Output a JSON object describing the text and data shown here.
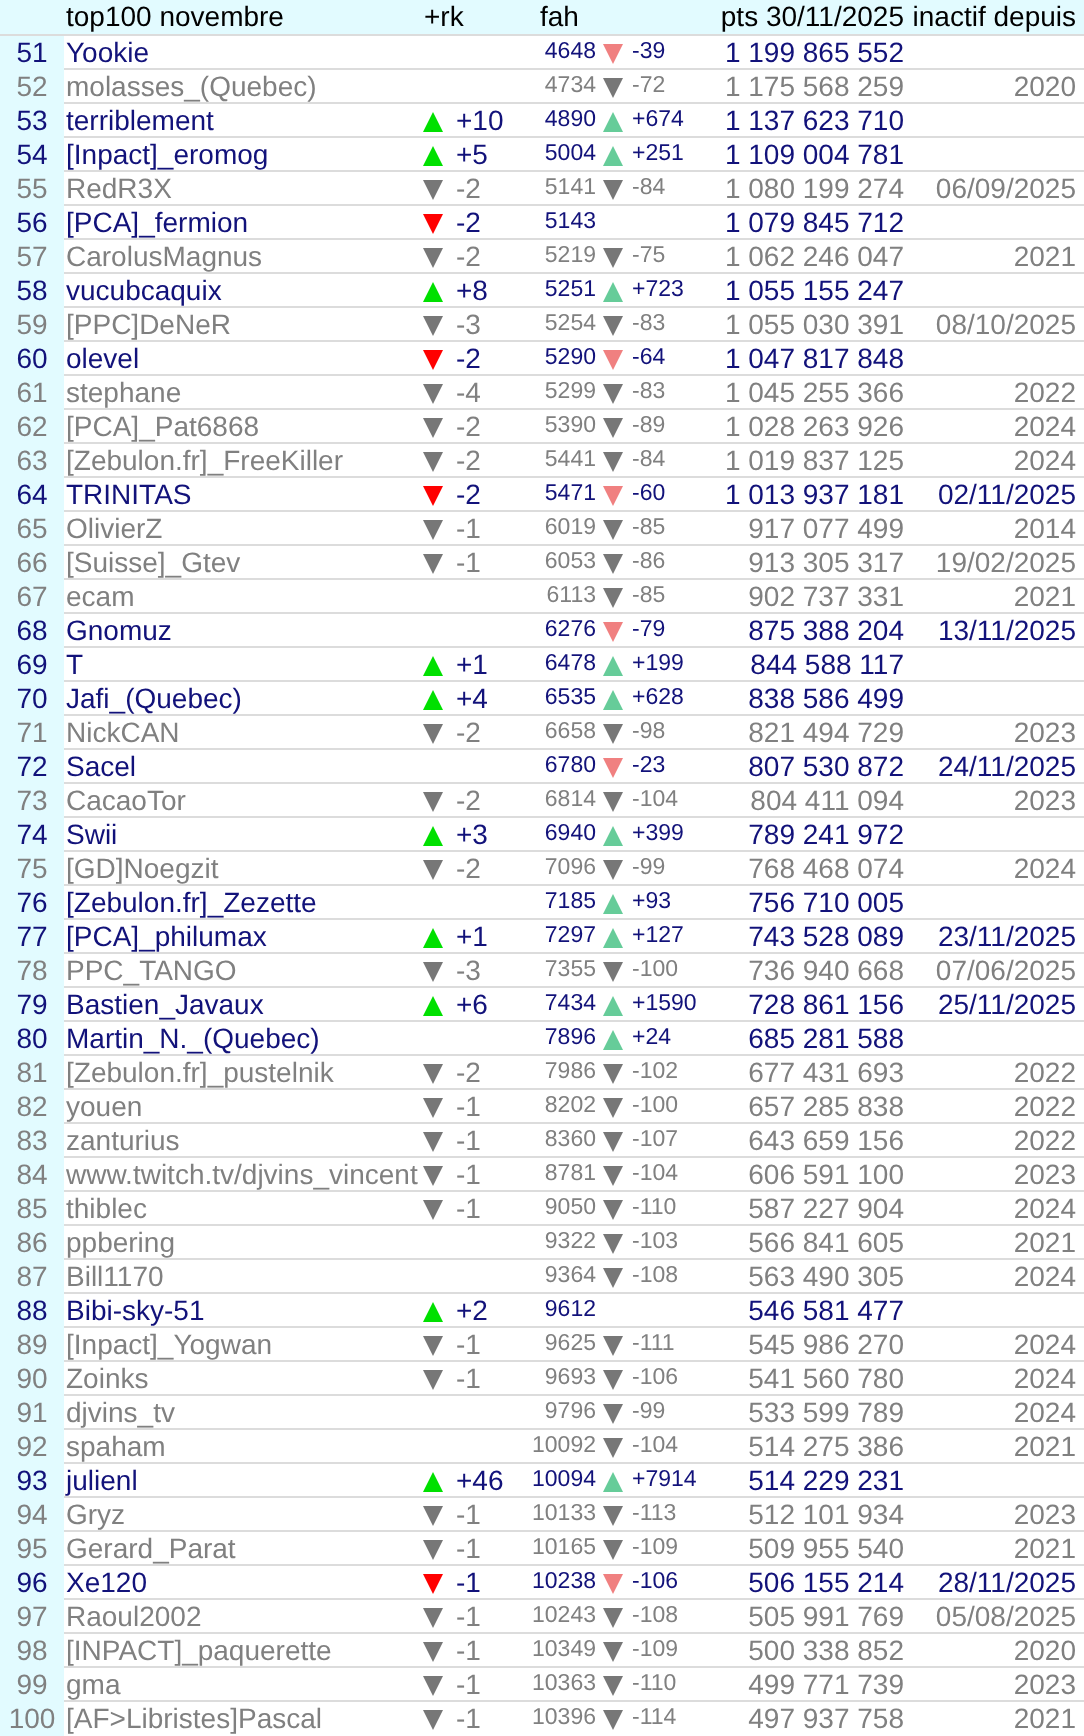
{
  "header": {
    "name": "top100 novembre",
    "rank_change": "+rk",
    "fah": "fah",
    "points": "pts 30/11/2025",
    "inactive_since": "inactif depuis"
  },
  "rows": [
    {
      "rank": "51",
      "name": "Yookie",
      "active": true,
      "fah": "4648",
      "fah_change": {
        "kind": "down",
        "value": "-39"
      },
      "points": "1 199 865 552"
    },
    {
      "rank": "52",
      "name": "molasses_(Quebec)",
      "active": false,
      "fah": "4734",
      "fah_change": {
        "kind": "down",
        "value": "-72"
      },
      "points": "1 175 568 259",
      "inactive_since": "2020"
    },
    {
      "rank": "53",
      "name": "terriblement",
      "active": true,
      "rank_change": {
        "kind": "up",
        "value": "+10"
      },
      "fah": "4890",
      "fah_change": {
        "kind": "up",
        "value": "+674"
      },
      "points": "1 137 623 710"
    },
    {
      "rank": "54",
      "name": "[Inpact]_eromog",
      "active": true,
      "rank_change": {
        "kind": "up",
        "value": "+5"
      },
      "fah": "5004",
      "fah_change": {
        "kind": "up",
        "value": "+251"
      },
      "points": "1 109 004 781"
    },
    {
      "rank": "55",
      "name": "RedR3X",
      "active": false,
      "rank_change": {
        "kind": "down",
        "value": "-2"
      },
      "fah": "5141",
      "fah_change": {
        "kind": "down",
        "value": "-84"
      },
      "points": "1 080 199 274",
      "inactive_since": "06/09/2025"
    },
    {
      "rank": "56",
      "name": "[PCA]_fermion",
      "active": true,
      "rank_change": {
        "kind": "down",
        "value": "-2"
      },
      "fah": "5143",
      "points": "1 079 845 712"
    },
    {
      "rank": "57",
      "name": "CarolusMagnus",
      "active": false,
      "rank_change": {
        "kind": "down",
        "value": "-2"
      },
      "fah": "5219",
      "fah_change": {
        "kind": "down",
        "value": "-75"
      },
      "points": "1 062 246 047",
      "inactive_since": "2021"
    },
    {
      "rank": "58",
      "name": "vucubcaquix",
      "active": true,
      "rank_change": {
        "kind": "up",
        "value": "+8"
      },
      "fah": "5251",
      "fah_change": {
        "kind": "up",
        "value": "+723"
      },
      "points": "1 055 155 247"
    },
    {
      "rank": "59",
      "name": "[PPC]DeNeR",
      "active": false,
      "rank_change": {
        "kind": "down",
        "value": "-3"
      },
      "fah": "5254",
      "fah_change": {
        "kind": "down",
        "value": "-83"
      },
      "points": "1 055 030 391",
      "inactive_since": "08/10/2025"
    },
    {
      "rank": "60",
      "name": "olevel",
      "active": true,
      "rank_change": {
        "kind": "down",
        "value": "-2"
      },
      "fah": "5290",
      "fah_change": {
        "kind": "down",
        "value": "-64"
      },
      "points": "1 047 817 848"
    },
    {
      "rank": "61",
      "name": "stephane",
      "active": false,
      "rank_change": {
        "kind": "down",
        "value": "-4"
      },
      "fah": "5299",
      "fah_change": {
        "kind": "down",
        "value": "-83"
      },
      "points": "1 045 255 366",
      "inactive_since": "2022"
    },
    {
      "rank": "62",
      "name": "[PCA]_Pat6868",
      "active": false,
      "rank_change": {
        "kind": "down",
        "value": "-2"
      },
      "fah": "5390",
      "fah_change": {
        "kind": "down",
        "value": "-89"
      },
      "points": "1 028 263 926",
      "inactive_since": "2024"
    },
    {
      "rank": "63",
      "name": "[Zebulon.fr]_FreeKiller",
      "active": false,
      "rank_change": {
        "kind": "down",
        "value": "-2"
      },
      "fah": "5441",
      "fah_change": {
        "kind": "down",
        "value": "-84"
      },
      "points": "1 019 837 125",
      "inactive_since": "2024"
    },
    {
      "rank": "64",
      "name": "TRINITAS",
      "active": true,
      "rank_change": {
        "kind": "down",
        "value": "-2"
      },
      "fah": "5471",
      "fah_change": {
        "kind": "down",
        "value": "-60"
      },
      "points": "1 013 937 181",
      "inactive_since": "02/11/2025"
    },
    {
      "rank": "65",
      "name": "OlivierZ",
      "active": false,
      "rank_change": {
        "kind": "down",
        "value": "-1"
      },
      "fah": "6019",
      "fah_change": {
        "kind": "down",
        "value": "-85"
      },
      "points": "917 077 499",
      "inactive_since": "2014"
    },
    {
      "rank": "66",
      "name": "[Suisse]_Gtev",
      "active": false,
      "rank_change": {
        "kind": "down",
        "value": "-1"
      },
      "fah": "6053",
      "fah_change": {
        "kind": "down",
        "value": "-86"
      },
      "points": "913 305 317",
      "inactive_since": "19/02/2025"
    },
    {
      "rank": "67",
      "name": "ecam",
      "active": false,
      "fah": "6113",
      "fah_change": {
        "kind": "down",
        "value": "-85"
      },
      "points": "902 737 331",
      "inactive_since": "2021"
    },
    {
      "rank": "68",
      "name": "Gnomuz",
      "active": true,
      "fah": "6276",
      "fah_change": {
        "kind": "down",
        "value": "-79"
      },
      "points": "875 388 204",
      "inactive_since": "13/11/2025"
    },
    {
      "rank": "69",
      "name": "T",
      "active": true,
      "rank_change": {
        "kind": "up",
        "value": "+1"
      },
      "fah": "6478",
      "fah_change": {
        "kind": "up",
        "value": "+199"
      },
      "points": "844 588 117"
    },
    {
      "rank": "70",
      "name": "Jafi_(Quebec)",
      "active": true,
      "rank_change": {
        "kind": "up",
        "value": "+4"
      },
      "fah": "6535",
      "fah_change": {
        "kind": "up",
        "value": "+628"
      },
      "points": "838 586 499"
    },
    {
      "rank": "71",
      "name": "NickCAN",
      "active": false,
      "rank_change": {
        "kind": "down",
        "value": "-2"
      },
      "fah": "6658",
      "fah_change": {
        "kind": "down",
        "value": "-98"
      },
      "points": "821 494 729",
      "inactive_since": "2023"
    },
    {
      "rank": "72",
      "name": "Sacel",
      "active": true,
      "fah": "6780",
      "fah_change": {
        "kind": "down",
        "value": "-23"
      },
      "points": "807 530 872",
      "inactive_since": "24/11/2025"
    },
    {
      "rank": "73",
      "name": "CacaoTor",
      "active": false,
      "rank_change": {
        "kind": "down",
        "value": "-2"
      },
      "fah": "6814",
      "fah_change": {
        "kind": "down",
        "value": "-104"
      },
      "points": "804 411 094",
      "inactive_since": "2023"
    },
    {
      "rank": "74",
      "name": "Swii",
      "active": true,
      "rank_change": {
        "kind": "up",
        "value": "+3"
      },
      "fah": "6940",
      "fah_change": {
        "kind": "up",
        "value": "+399"
      },
      "points": "789 241 972"
    },
    {
      "rank": "75",
      "name": "[GD]Noegzit",
      "active": false,
      "rank_change": {
        "kind": "down",
        "value": "-2"
      },
      "fah": "7096",
      "fah_change": {
        "kind": "down",
        "value": "-99"
      },
      "points": "768 468 074",
      "inactive_since": "2024"
    },
    {
      "rank": "76",
      "name": "[Zebulon.fr]_Zezette",
      "active": true,
      "fah": "7185",
      "fah_change": {
        "kind": "up",
        "value": "+93"
      },
      "points": "756 710 005"
    },
    {
      "rank": "77",
      "name": "[PCA]_philumax",
      "active": true,
      "rank_change": {
        "kind": "up",
        "value": "+1"
      },
      "fah": "7297",
      "fah_change": {
        "kind": "up",
        "value": "+127"
      },
      "points": "743 528 089",
      "inactive_since": "23/11/2025"
    },
    {
      "rank": "78",
      "name": "PPC_TANGO",
      "active": false,
      "rank_change": {
        "kind": "down",
        "value": "-3"
      },
      "fah": "7355",
      "fah_change": {
        "kind": "down",
        "value": "-100"
      },
      "points": "736 940 668",
      "inactive_since": "07/06/2025"
    },
    {
      "rank": "79",
      "name": "Bastien_Javaux",
      "active": true,
      "rank_change": {
        "kind": "up",
        "value": "+6"
      },
      "fah": "7434",
      "fah_change": {
        "kind": "up",
        "value": "+1590"
      },
      "points": "728 861 156",
      "inactive_since": "25/11/2025"
    },
    {
      "rank": "80",
      "name": "Martin_N._(Quebec)",
      "active": true,
      "fah": "7896",
      "fah_change": {
        "kind": "up",
        "value": "+24"
      },
      "points": "685 281 588"
    },
    {
      "rank": "81",
      "name": "[Zebulon.fr]_pustelnik",
      "active": false,
      "rank_change": {
        "kind": "down",
        "value": "-2"
      },
      "fah": "7986",
      "fah_change": {
        "kind": "down",
        "value": "-102"
      },
      "points": "677 431 693",
      "inactive_since": "2022"
    },
    {
      "rank": "82",
      "name": "youen",
      "active": false,
      "rank_change": {
        "kind": "down",
        "value": "-1"
      },
      "fah": "8202",
      "fah_change": {
        "kind": "down",
        "value": "-100"
      },
      "points": "657 285 838",
      "inactive_since": "2022"
    },
    {
      "rank": "83",
      "name": "zanturius",
      "active": false,
      "rank_change": {
        "kind": "down",
        "value": "-1"
      },
      "fah": "8360",
      "fah_change": {
        "kind": "down",
        "value": "-107"
      },
      "points": "643 659 156",
      "inactive_since": "2022"
    },
    {
      "rank": "84",
      "name": "www.twitch.tv/djvins_vincent",
      "active": false,
      "rank_change": {
        "kind": "down",
        "value": "-1"
      },
      "fah": "8781",
      "fah_change": {
        "kind": "down",
        "value": "-104"
      },
      "points": "606 591 100",
      "inactive_since": "2023"
    },
    {
      "rank": "85",
      "name": "thiblec",
      "active": false,
      "rank_change": {
        "kind": "down",
        "value": "-1"
      },
      "fah": "9050",
      "fah_change": {
        "kind": "down",
        "value": "-110"
      },
      "points": "587 227 904",
      "inactive_since": "2024"
    },
    {
      "rank": "86",
      "name": "ppbering",
      "active": false,
      "fah": "9322",
      "fah_change": {
        "kind": "down",
        "value": "-103"
      },
      "points": "566 841 605",
      "inactive_since": "2021"
    },
    {
      "rank": "87",
      "name": "Bill1170",
      "active": false,
      "fah": "9364",
      "fah_change": {
        "kind": "down",
        "value": "-108"
      },
      "points": "563 490 305",
      "inactive_since": "2024"
    },
    {
      "rank": "88",
      "name": "Bibi-sky-51",
      "active": true,
      "rank_change": {
        "kind": "up",
        "value": "+2"
      },
      "fah": "9612",
      "points": "546 581 477"
    },
    {
      "rank": "89",
      "name": "[Inpact]_Yogwan",
      "active": false,
      "rank_change": {
        "kind": "down",
        "value": "-1"
      },
      "fah": "9625",
      "fah_change": {
        "kind": "down",
        "value": "-111"
      },
      "points": "545 986 270",
      "inactive_since": "2024"
    },
    {
      "rank": "90",
      "name": "Zoinks",
      "active": false,
      "rank_change": {
        "kind": "down",
        "value": "-1"
      },
      "fah": "9693",
      "fah_change": {
        "kind": "down",
        "value": "-106"
      },
      "points": "541 560 780",
      "inactive_since": "2024"
    },
    {
      "rank": "91",
      "name": "djvins_tv",
      "active": false,
      "fah": "9796",
      "fah_change": {
        "kind": "down",
        "value": "-99"
      },
      "points": "533 599 789",
      "inactive_since": "2024"
    },
    {
      "rank": "92",
      "name": "spaham",
      "active": false,
      "fah": "10092",
      "fah_change": {
        "kind": "down",
        "value": "-104"
      },
      "points": "514 275 386",
      "inactive_since": "2021"
    },
    {
      "rank": "93",
      "name": "julienl",
      "active": true,
      "rank_change": {
        "kind": "up",
        "value": "+46"
      },
      "fah": "10094",
      "fah_change": {
        "kind": "up",
        "value": "+7914"
      },
      "points": "514 229 231"
    },
    {
      "rank": "94",
      "name": "Gryz",
      "active": false,
      "rank_change": {
        "kind": "down",
        "value": "-1"
      },
      "fah": "10133",
      "fah_change": {
        "kind": "down",
        "value": "-113"
      },
      "points": "512 101 934",
      "inactive_since": "2023"
    },
    {
      "rank": "95",
      "name": "Gerard_Parat",
      "active": false,
      "rank_change": {
        "kind": "down",
        "value": "-1"
      },
      "fah": "10165",
      "fah_change": {
        "kind": "down",
        "value": "-109"
      },
      "points": "509 955 540",
      "inactive_since": "2021"
    },
    {
      "rank": "96",
      "name": "Xe120",
      "active": true,
      "rank_change": {
        "kind": "down",
        "value": "-1"
      },
      "fah": "10238",
      "fah_change": {
        "kind": "down",
        "value": "-106"
      },
      "points": "506 155 214",
      "inactive_since": "28/11/2025"
    },
    {
      "rank": "97",
      "name": "Raoul2002",
      "active": false,
      "rank_change": {
        "kind": "down",
        "value": "-1"
      },
      "fah": "10243",
      "fah_change": {
        "kind": "down",
        "value": "-108"
      },
      "points": "505 991 769",
      "inactive_since": "05/08/2025"
    },
    {
      "rank": "98",
      "name": "[INPACT]_paquerette",
      "active": false,
      "rank_change": {
        "kind": "down",
        "value": "-1"
      },
      "fah": "10349",
      "fah_change": {
        "kind": "down",
        "value": "-109"
      },
      "points": "500 338 852",
      "inactive_since": "2020"
    },
    {
      "rank": "99",
      "name": "gma",
      "active": false,
      "rank_change": {
        "kind": "down",
        "value": "-1"
      },
      "fah": "10363",
      "fah_change": {
        "kind": "down",
        "value": "-110"
      },
      "points": "499 771 739",
      "inactive_since": "2023"
    },
    {
      "rank": "100",
      "name": "[AF>Libristes]Pascal",
      "active": false,
      "rank_change": {
        "kind": "down",
        "value": "-1"
      },
      "fah": "10396",
      "fah_change": {
        "kind": "down",
        "value": "-114"
      },
      "points": "497 937 758",
      "inactive_since": "2021"
    }
  ]
}
